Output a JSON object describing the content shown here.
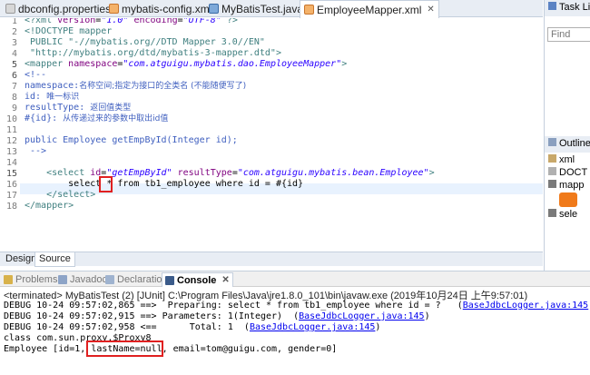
{
  "tabs": [
    {
      "label": "dbconfig.properties",
      "icon": "properties-file-icon",
      "active": false
    },
    {
      "label": "mybatis-config.xml",
      "icon": "xml-file-icon",
      "active": false
    },
    {
      "label": "MyBatisTest.java",
      "icon": "java-file-icon",
      "active": false
    },
    {
      "label": "EmployeeMapper.xml",
      "icon": "xml-file-icon",
      "active": true
    }
  ],
  "editor": {
    "line_numbers": [
      "1",
      "2",
      "3",
      "4",
      "5",
      "6",
      "7",
      "8",
      "9",
      "10",
      "11",
      "12",
      "13",
      "14",
      "15",
      "16",
      "17",
      "18"
    ],
    "lines": {
      "l1a": "<?xml ",
      "l1b": "version",
      "l1c": "=",
      "l1d": "\"1.0\"",
      "l1e": " encoding",
      "l1f": "=",
      "l1g": "\"UTF-8\"",
      "l1h": " ?>",
      "l2": "<!DOCTYPE mapper",
      "l3": " PUBLIC \"-//mybatis.org//DTD Mapper 3.0//EN\"",
      "l4": " \"http://mybatis.org/dtd/mybatis-3-mapper.dtd\">",
      "l5a": "<mapper ",
      "l5b": "namespace",
      "l5c": "=",
      "l5d": "\"com.atguigu.mybatis.dao.EmployeeMapper\"",
      "l5e": ">",
      "l6": "<!--",
      "l7a": "namespace:",
      "l7b": "名称空间;指定为接口的全类名 (不能随便写了)",
      "l8a": "id: ",
      "l8b": "唯一标识",
      "l9a": "resultType: ",
      "l9b": "返回值类型",
      "l10a": "#{id}: ",
      "l10b": "从传递过来的参数中取出id值",
      "l11": "",
      "l12": "public Employee getEmpById(Integer id);",
      "l13": " -->",
      "l14": "",
      "l15a": "    <select ",
      "l15b": "id",
      "l15c": "=",
      "l15d": "\"getEmpById\"",
      "l15e": " resultType",
      "l15f": "=",
      "l15g": "\"com.atguigu.mybatis.bean.Employee\"",
      "l15h": ">",
      "l16a": "        select ",
      "l16b": "*",
      "l16c": " from tb1_employee where id = #{id}",
      "l17": "    </select>",
      "l18": "</mapper>"
    }
  },
  "bottom_editor_tabs": [
    "Design",
    "Source"
  ],
  "console_tabs": [
    {
      "label": "Problems",
      "icon": "problems-icon"
    },
    {
      "label": "Javadoc",
      "icon": "javadoc-icon"
    },
    {
      "label": "Declaration",
      "icon": "declaration-icon"
    },
    {
      "label": "Console",
      "icon": "console-icon",
      "active": true
    }
  ],
  "console": {
    "terminated": "<terminated> MyBatisTest (2) [JUnit] C:\\Program Files\\Java\\jre1.8.0_101\\bin\\javaw.exe (2019年10月24日 上午9:57:01)",
    "lines": [
      {
        "text": "DEBUG 10-24 09:57:02,865 ==>  Preparing: select * from tb1_employee where id = ?   (",
        "link": "BaseJdbcLogger.java:145",
        "tail": ")"
      },
      {
        "text": "DEBUG 10-24 09:57:02,915 ==> Parameters: 1(Integer)  (",
        "link": "BaseJdbcLogger.java:145",
        "tail": ")"
      },
      {
        "text": "DEBUG 10-24 09:57:02,958 <==      Total: 1  (",
        "link": "BaseJdbcLogger.java:145",
        "tail": ")"
      },
      {
        "text": "class com.sun.proxy.$Proxy8",
        "link": "",
        "tail": ""
      },
      {
        "text": "Employee [id=1, lastName=null, email=tom@guigu.com, gender=0]",
        "link": "",
        "tail": ""
      }
    ]
  },
  "right": {
    "task_list_title": "Task List",
    "find_placeholder": "Find",
    "outline_title": "Outline",
    "outline_items": [
      "xml",
      "DOCT",
      "mapp",
      "sele"
    ]
  },
  "colors": {
    "highlight_box": "#e02020",
    "current_line": "#e8f2fe",
    "xml_tag": "#3f7f7f",
    "xml_attr": "#7f007f",
    "xml_string": "#2a00ff",
    "comment": "#3f5fbf"
  }
}
